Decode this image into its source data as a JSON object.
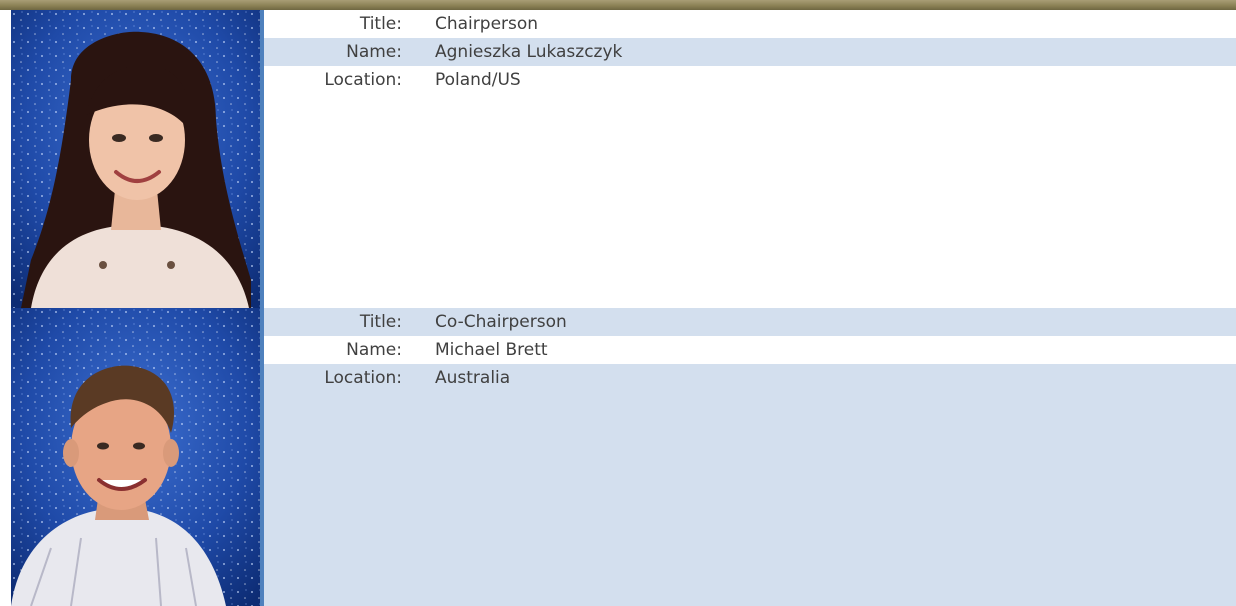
{
  "colors": {
    "accent_rule": "#4f81bd",
    "row_shade": "#d3dfee",
    "top_bar": "#8c8256",
    "text": "#404040"
  },
  "profiles": [
    {
      "photo_icon": "person-photo",
      "fields": [
        {
          "label": "Title:",
          "value": "Chairperson"
        },
        {
          "label": "Name:",
          "value": "Agnieszka Lukaszczyk"
        },
        {
          "label": "Location:",
          "value": "Poland/US"
        }
      ]
    },
    {
      "photo_icon": "person-photo",
      "fields": [
        {
          "label": "Title:",
          "value": "Co-Chairperson"
        },
        {
          "label": "Name:",
          "value": "Michael Brett"
        },
        {
          "label": "Location:",
          "value": "Australia"
        }
      ]
    }
  ]
}
